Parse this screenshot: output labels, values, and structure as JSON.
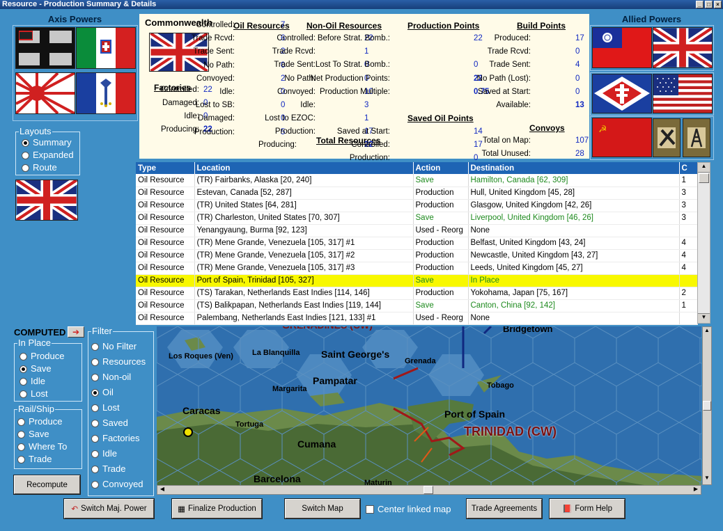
{
  "window": {
    "title": "Resource - Production Summary & Details"
  },
  "axis": {
    "label": "Axis Powers"
  },
  "allied": {
    "label": "Allied Powers"
  },
  "layouts": {
    "legend": "Layouts",
    "options": [
      "Summary",
      "Expanded",
      "Route"
    ],
    "selected": "Summary"
  },
  "summary": {
    "nation": "Commonwealth",
    "factories": {
      "title": "Factories",
      "rows": [
        [
          "Controlled:",
          "22"
        ],
        [
          "Damaged:",
          "0"
        ],
        [
          "Idle:",
          "0"
        ],
        [
          "Producing:",
          "22"
        ]
      ]
    },
    "oil": {
      "title": "Oil Resources",
      "rows": [
        [
          "Controlled:",
          "7"
        ],
        [
          "Trade Rcvd:",
          "6"
        ],
        [
          "Trade Sent:",
          "2"
        ],
        [
          "No Path:",
          "0"
        ],
        [
          "Convoyed:",
          "2"
        ],
        [
          "Idle:",
          "0"
        ],
        [
          "Lost to SB:",
          "0"
        ],
        [
          "Damaged:",
          "0"
        ],
        [
          "Production:",
          "5"
        ]
      ]
    },
    "nonoil": {
      "title": "Non-Oil Resources",
      "rows": [
        [
          "Controlled:",
          "22"
        ],
        [
          "Trade Rcvd:",
          "1"
        ],
        [
          "Trade Sent:",
          "0"
        ],
        [
          "No Path:",
          "0"
        ],
        [
          "Convoyed:",
          "10"
        ],
        [
          "Idle:",
          "3"
        ],
        [
          "Lost to EZOC:",
          "1"
        ],
        [
          "Production:",
          "17"
        ]
      ]
    },
    "total": {
      "title": "Total Resources",
      "rows": [
        [
          "Producing:",
          "22"
        ]
      ]
    },
    "pp": {
      "title": "Production Points",
      "rows": [
        [
          "Before Strat. Bomb.:",
          "22"
        ],
        [
          "Lost To Strat. Bomb.:",
          "0"
        ],
        [
          "Net Production Points:",
          "22"
        ],
        [
          "Production Multiple:",
          "0.75"
        ]
      ]
    },
    "saved": {
      "title": "Saved Oil Points",
      "rows": [
        [
          "Saved at Start:",
          "14"
        ],
        [
          "Controlled:",
          "17"
        ],
        [
          "Production:",
          "0"
        ]
      ]
    },
    "bp": {
      "title": "Build Points",
      "rows": [
        [
          "Produced:",
          "17"
        ],
        [
          "Trade Rcvd:",
          "0"
        ],
        [
          "Trade Sent:",
          "4"
        ],
        [
          "No Path (Lost):",
          "0"
        ],
        [
          "Saved at Start:",
          "0"
        ],
        [
          "Available:",
          "13"
        ]
      ]
    },
    "convoys": {
      "title": "Convoys",
      "rows": [
        [
          "Total on Map:",
          "107"
        ],
        [
          "Total Unused:",
          "28"
        ]
      ]
    }
  },
  "table": {
    "headers": [
      "Type",
      "Location",
      "Action",
      "Destination",
      "C"
    ],
    "rows": [
      [
        "Oil Resource",
        "(TR) Fairbanks, Alaska [20, 240]",
        "Save",
        "Hamilton, Canada [62, 309]",
        "1"
      ],
      [
        "Oil Resource",
        "Estevan, Canada [52, 287]",
        "Production",
        "Hull, United Kingdom [45, 28]",
        "3"
      ],
      [
        "Oil Resource",
        "(TR) United States [64, 281]",
        "Production",
        "Glasgow, United Kingdom [42, 26]",
        "3"
      ],
      [
        "Oil Resource",
        "(TR) Charleston, United States [70, 307]",
        "Save",
        "Liverpool, United Kingdom [46, 26]",
        "3"
      ],
      [
        "Oil Resource",
        "Yenangyaung, Burma [92, 123]",
        "Used - Reorg",
        "None",
        ""
      ],
      [
        "Oil Resource",
        "(TR) Mene Grande, Venezuela [105, 317] #1",
        "Production",
        "Belfast, United Kingdom [43, 24]",
        "4"
      ],
      [
        "Oil Resource",
        "(TR) Mene Grande, Venezuela [105, 317] #2",
        "Production",
        "Newcastle, United Kingdom [43, 27]",
        "4"
      ],
      [
        "Oil Resource",
        "(TR) Mene Grande, Venezuela [105, 317] #3",
        "Production",
        "Leeds, United Kingdom [45, 27]",
        "4"
      ],
      [
        "Oil Resource",
        "Port of Spain, Trinidad [105, 327]",
        "Save",
        "In Place",
        ""
      ],
      [
        "Oil Resource",
        "(TS) Tarakan, Netherlands East Indies [114, 146]",
        "Production",
        "Yokohama, Japan [75, 167]",
        "2"
      ],
      [
        "Oil Resource",
        "(TS) Balikpapan, Netherlands East Indies [119, 144]",
        "Save",
        "Canton, China [92, 142]",
        "1"
      ],
      [
        "Oil Resource",
        "Palembang, Netherlands East Indies [121, 133] #1",
        "Used - Reorg",
        "None",
        ""
      ]
    ],
    "highlight_row": 8
  },
  "computed": {
    "label": "COMPUTED"
  },
  "inplace": {
    "legend": "In Place",
    "options": [
      "Produce",
      "Save",
      "Idle",
      "Lost"
    ],
    "selected": "Save"
  },
  "railship": {
    "legend": "Rail/Ship",
    "options": [
      "Produce",
      "Save",
      "Where To",
      "Trade"
    ]
  },
  "filter": {
    "legend": "Filter",
    "options": [
      "No Filter",
      "Resources",
      "Non-oil",
      "Oil",
      "Lost",
      "Saved",
      "Factories",
      "Idle",
      "Trade",
      "Convoyed"
    ],
    "selected": "Oil"
  },
  "buttons": {
    "recompute": "Recompute",
    "switch_power": "Switch Maj. Power",
    "finalize": "Finalize Production",
    "switch_map": "Switch Map",
    "center_map": "Center linked map",
    "trade": "Trade Agreements",
    "help": "Form Help"
  },
  "map": {
    "labels": [
      "Bridgetown",
      "Los Roques (Ven)",
      "La Blanquilla",
      "Saint George's",
      "Grenada",
      "Pampatar",
      "Margarita",
      "Tobago",
      "Caracas",
      "Tortuga",
      "Port of Spain",
      "TRINIDAD (CW)",
      "Cumana",
      "Barcelona",
      "Maturin"
    ],
    "top_cut": "GRENADINES (CW)"
  }
}
